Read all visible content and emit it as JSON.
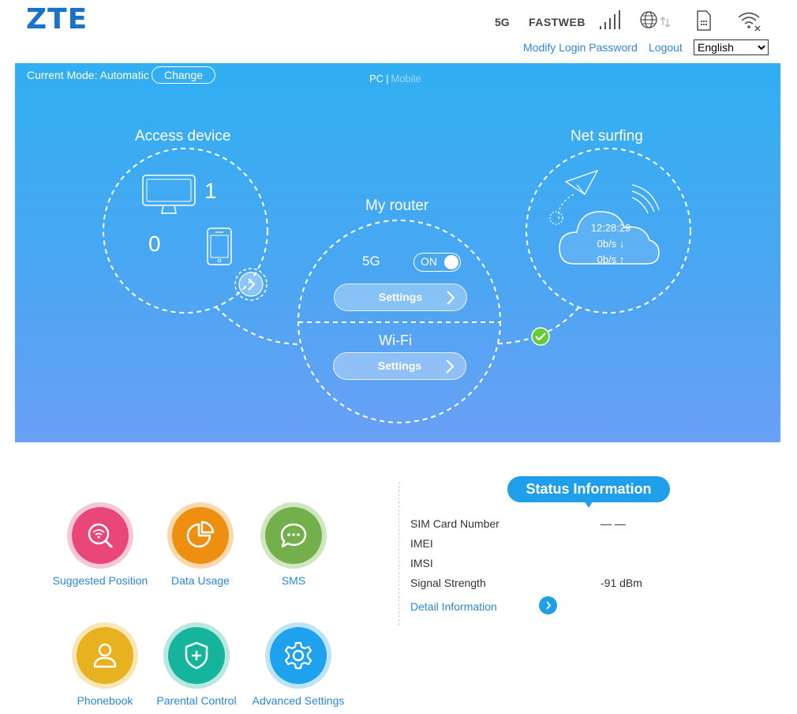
{
  "header": {
    "logo": "ZTE",
    "network_type": "5G",
    "carrier": "FASTWEB",
    "icons": [
      "signal-strength-icon",
      "globe-data-icon",
      "sim-card-icon",
      "wifi-disconnected-icon"
    ],
    "links": {
      "modify_password": "Modify Login Password",
      "logout": "Logout"
    },
    "language": {
      "selected": "English"
    }
  },
  "hero": {
    "mode_label": "Current Mode: Automatic",
    "change_label": "Change",
    "view": {
      "pc": "PC",
      "separator": "|",
      "mobile": "Mobile"
    },
    "access_device": {
      "title": "Access device",
      "pc_count": "1",
      "mobile_count": "0"
    },
    "my_router": {
      "title": "My router",
      "band": "5G",
      "band_toggle": "ON",
      "settings_5g": "Settings",
      "wifi_title": "Wi-Fi",
      "settings_wifi": "Settings"
    },
    "net_surfing": {
      "title": "Net surfing",
      "time": "12:28:29",
      "download": "0b/s ↓",
      "upload": "0b/s ↑"
    }
  },
  "shortcuts": [
    {
      "label": "Suggested Position",
      "icon": "wifi-search-icon",
      "color": "#e9467a",
      "ring": "#f6c7d6"
    },
    {
      "label": "Data Usage",
      "icon": "pie-chart-icon",
      "color": "#ee8f12",
      "ring": "#f9d9ad"
    },
    {
      "label": "SMS",
      "icon": "chat-bubble-icon",
      "color": "#73b04b",
      "ring": "#cfe6c0"
    },
    {
      "label": "Phonebook",
      "icon": "person-icon",
      "color": "#e8b11f",
      "ring": "#f7e7b4"
    },
    {
      "label": "Parental Control",
      "icon": "shield-plus-icon",
      "color": "#14b49d",
      "ring": "#b8e8e0"
    },
    {
      "label": "Advanced Settings",
      "icon": "gear-icon",
      "color": "#1fa2ee",
      "ring": "#bfe3f8"
    }
  ],
  "status": {
    "title": "Status Information",
    "rows": [
      {
        "label": "SIM Card Number",
        "value": "— —"
      },
      {
        "label": "IMEI",
        "value": ""
      },
      {
        "label": "IMSI",
        "value": ""
      },
      {
        "label": "Signal Strength",
        "value": "-91 dBm"
      }
    ],
    "detail_link": "Detail Information"
  },
  "colors": {
    "brand": "#1a73c9",
    "link": "#2b86d9",
    "hero_top": "#31aff2",
    "hero_bottom": "#6aa0f5",
    "status_badge": "#1f9ee9",
    "connected": "#66cc33"
  }
}
